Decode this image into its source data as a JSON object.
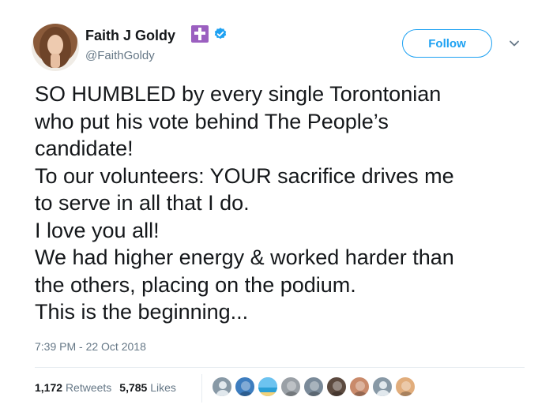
{
  "user": {
    "name": "Faith J Goldy",
    "handle": "@FaithGoldy"
  },
  "follow_label": "Follow",
  "tweet_lines": [
    "SO HUMBLED by every single Torontonian",
    "who put his vote behind The People’s",
    "candidate!",
    "To our volunteers: YOUR sacrifice drives me",
    "to serve in all that I do.",
    "I love you all!",
    "We had higher energy & worked harder than",
    "the others, placing on the podium.",
    "This is the beginning..."
  ],
  "timestamp": "7:39 PM - 22 Oct 2018",
  "stats": {
    "retweets_count": "1,172",
    "retweets_label": "Retweets",
    "likes_count": "5,785",
    "likes_label": "Likes"
  },
  "icons": {
    "cross_badge": "cross-icon",
    "verified": "verified-icon",
    "caret": "chevron-down-icon"
  },
  "colors": {
    "accent": "#1da1f2",
    "muted": "#657786",
    "text": "#14171a",
    "cross_badge": "#9b5fc0"
  },
  "liker_avatars": [
    {
      "name": "liker-avatar-1",
      "bg": "#8899a6",
      "style": "default"
    },
    {
      "name": "liker-avatar-2",
      "bg": "#3d7dbf",
      "style": "photo"
    },
    {
      "name": "liker-avatar-3",
      "bg": "#5aa9e6",
      "style": "beach"
    },
    {
      "name": "liker-avatar-4",
      "bg": "#9aa0a6",
      "style": "photo"
    },
    {
      "name": "liker-avatar-5",
      "bg": "#7a8a99",
      "style": "photo"
    },
    {
      "name": "liker-avatar-6",
      "bg": "#5c4a3f",
      "style": "photo"
    },
    {
      "name": "liker-avatar-7",
      "bg": "#c98a6b",
      "style": "photo"
    },
    {
      "name": "liker-avatar-8",
      "bg": "#8899a6",
      "style": "default"
    },
    {
      "name": "liker-avatar-9",
      "bg": "#e1ad7c",
      "style": "photo"
    }
  ]
}
